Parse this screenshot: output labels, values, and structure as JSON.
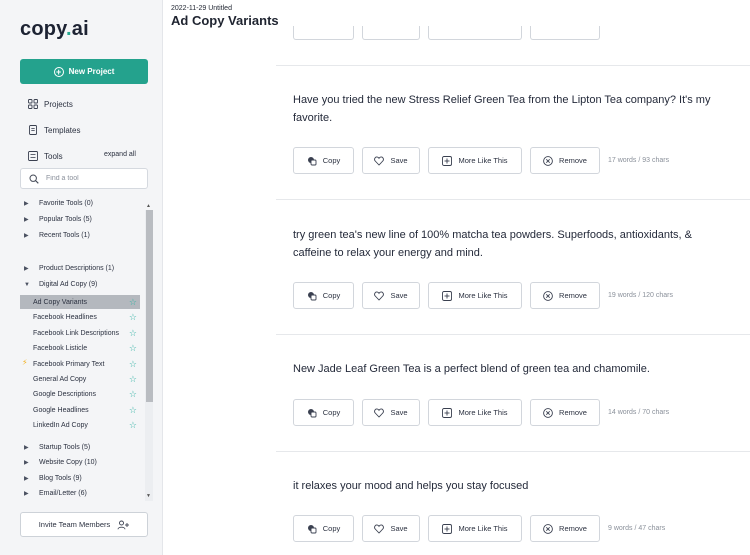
{
  "brand": {
    "name": "copy",
    "dot": ".",
    "suffix": "ai"
  },
  "sidebar": {
    "new_project": "New Project",
    "projects": "Projects",
    "templates": "Templates",
    "tools": "Tools",
    "expand_all": "expand all",
    "search_placeholder": "Find a tool",
    "groups_top": [
      {
        "label": "Favorite Tools (0)"
      },
      {
        "label": "Popular Tools (5)"
      },
      {
        "label": "Recent Tools (1)"
      },
      {
        "label": "Product Descriptions (1)"
      },
      {
        "label": "Digital Ad Copy (9)"
      }
    ],
    "digital_ad_items": [
      {
        "label": "Ad Copy Variants"
      },
      {
        "label": "Facebook Headlines"
      },
      {
        "label": "Facebook Link Descriptions"
      },
      {
        "label": "Facebook Listicle"
      },
      {
        "label": "Facebook Primary Text"
      },
      {
        "label": "General Ad Copy"
      },
      {
        "label": "Google Descriptions"
      },
      {
        "label": "Google Headlines"
      },
      {
        "label": "LinkedIn Ad Copy"
      }
    ],
    "groups_bottom": [
      {
        "label": "Startup Tools (5)"
      },
      {
        "label": "Website Copy (10)"
      },
      {
        "label": "Blog Tools (9)"
      },
      {
        "label": "Email/Letter (6)"
      }
    ],
    "invite": "Invite Team Members"
  },
  "header": {
    "date": "2022-11-29 Untitled",
    "title": "Ad Copy Variants"
  },
  "actions": {
    "copy": "Copy",
    "save": "Save",
    "more": "More Like This",
    "remove": "Remove"
  },
  "results": [
    {
      "text": "Have you tried the new Stress Relief Green Tea from the Lipton Tea company? It's my favorite.",
      "stats": "17 words / 93 chars"
    },
    {
      "text": "try green tea's new line of 100% matcha tea powders. Superfoods, antioxidants, & caffeine to relax your energy and mind.",
      "stats": "19 words / 120 chars"
    },
    {
      "text": "New Jade Leaf Green Tea is a perfect blend of green tea and chamomile.",
      "stats": "14 words / 70 chars"
    },
    {
      "text": "it relaxes your mood and helps you stay focused",
      "stats": "9 words / 47 chars"
    }
  ],
  "colors": {
    "accent": "#24a28d",
    "star": "#35b3a5",
    "bolt": "#f2b01e"
  }
}
